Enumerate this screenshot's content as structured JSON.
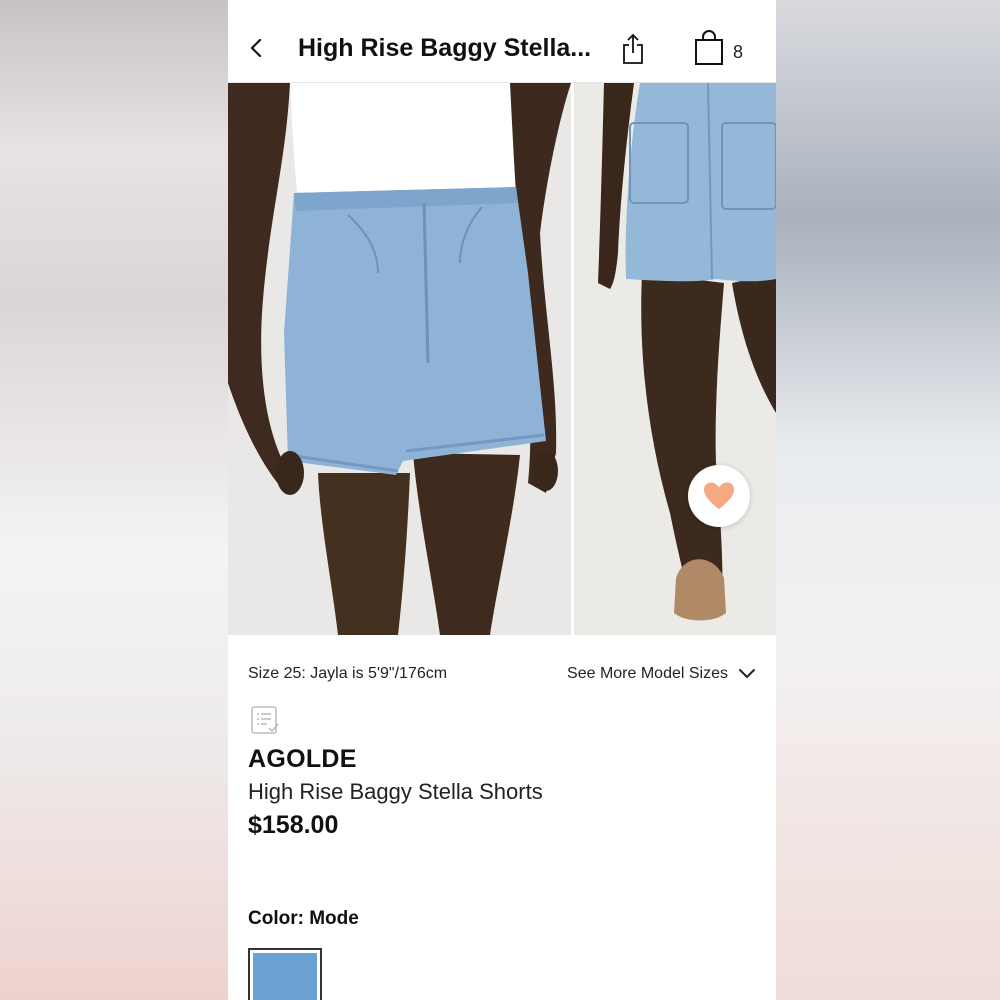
{
  "header": {
    "title": "High Rise Baggy Stella...",
    "bag_count": "8"
  },
  "model_info": {
    "size_text": "Size 25: Jayla is 5'9\"/176cm",
    "more_sizes_label": "See More Model Sizes"
  },
  "product": {
    "brand": "AGOLDE",
    "name": "High Rise Baggy Stella Shorts",
    "price": "$158.00"
  },
  "color": {
    "label": "Color: Mode",
    "swatch_color": "#6aa2d2"
  },
  "icons": {
    "back": "chevron-left-icon",
    "share": "share-icon",
    "bag": "shopping-bag-icon",
    "favorite": "heart-icon",
    "list": "checklist-icon",
    "dropdown": "chevron-down-icon"
  },
  "colors": {
    "heart": "#f5a983",
    "denim": "#8fb3d6"
  }
}
